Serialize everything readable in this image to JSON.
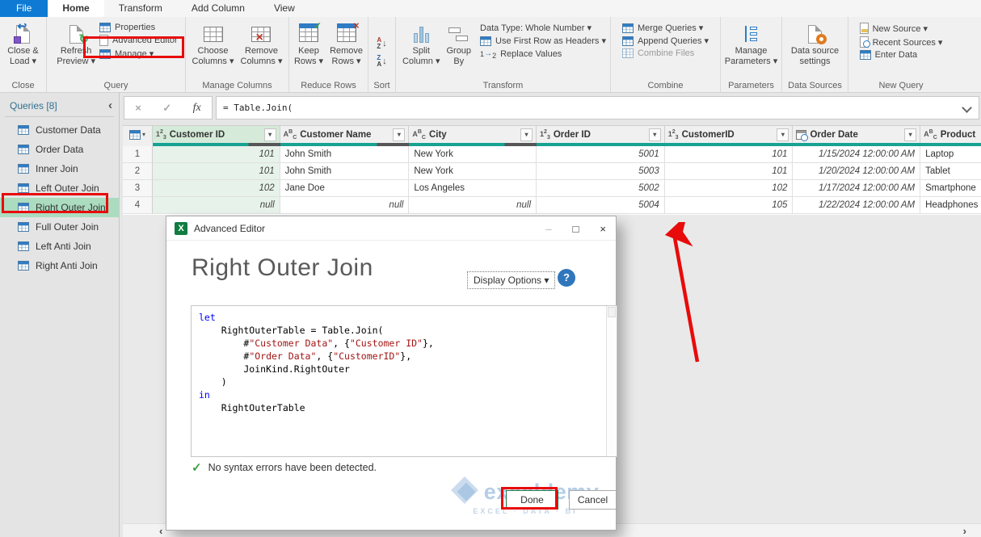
{
  "tabs": {
    "file": "File",
    "home": "Home",
    "transform": "Transform",
    "add_column": "Add Column",
    "view": "View"
  },
  "ribbon": {
    "close": {
      "group": "Close",
      "l1": "Close &",
      "l2": "Load ▾"
    },
    "query": {
      "group": "Query",
      "refresh1": "Refresh",
      "refresh2": "Preview ▾",
      "properties": "Properties",
      "advanced_editor": "Advanced Editor",
      "manage": "Manage ▾"
    },
    "manage_columns": {
      "group": "Manage Columns",
      "choose1": "Choose",
      "choose2": "Columns ▾",
      "remove1": "Remove",
      "remove2": "Columns ▾"
    },
    "reduce_rows": {
      "group": "Reduce Rows",
      "keep1": "Keep",
      "keep2": "Rows ▾",
      "remove1": "Remove",
      "remove2": "Rows ▾"
    },
    "sort": {
      "group": "Sort",
      "az_a": "A",
      "az_z": "Z",
      "za_z": "Z",
      "za_a": "A",
      "arrow": "↓"
    },
    "transform": {
      "group": "Transform",
      "split1": "Split",
      "split2": "Column ▾",
      "group1": "Group",
      "group2": "By",
      "data_type": "Data Type: Whole Number ▾",
      "first_row": "Use First Row as Headers ▾",
      "replace": "Replace Values",
      "rv1": "1",
      "rv2": "2",
      "rv_arrow": "→"
    },
    "combine": {
      "group": "Combine",
      "merge": "Merge Queries ▾",
      "append": "Append Queries ▾",
      "combine_files": "Combine Files"
    },
    "parameters": {
      "group": "Parameters",
      "l1": "Manage",
      "l2": "Parameters ▾"
    },
    "data_sources": {
      "group": "Data Sources",
      "l1": "Data source",
      "l2": "settings"
    },
    "new_query": {
      "group": "New Query",
      "new_source": "New Source ▾",
      "recent": "Recent Sources ▾",
      "enter": "Enter Data"
    }
  },
  "formula_bar": {
    "cancel": "×",
    "check": "✓",
    "fx": "fx",
    "expression": "= Table.Join("
  },
  "sidebar": {
    "title": "Queries [8]",
    "collapse": "‹",
    "items": [
      {
        "label": "Customer Data",
        "selected": false
      },
      {
        "label": "Order Data",
        "selected": false
      },
      {
        "label": "Inner Join",
        "selected": false
      },
      {
        "label": "Left Outer Join",
        "selected": false
      },
      {
        "label": "Right Outer Join",
        "selected": true
      },
      {
        "label": "Full Outer Join",
        "selected": false
      },
      {
        "label": "Left Anti Join",
        "selected": false
      },
      {
        "label": "Right Anti Join",
        "selected": false
      }
    ]
  },
  "grid": {
    "columns": [
      {
        "label": "Customer ID",
        "type": "number"
      },
      {
        "label": "Customer Name",
        "type": "text"
      },
      {
        "label": "City",
        "type": "text"
      },
      {
        "label": "Order ID",
        "type": "number"
      },
      {
        "label": "CustomerID",
        "type": "number"
      },
      {
        "label": "Order Date",
        "type": "datetime"
      },
      {
        "label": "Product",
        "type": "text"
      }
    ],
    "rows": [
      {
        "num": "1",
        "cells": [
          "101",
          "John Smith",
          "New York",
          "5001",
          "101",
          "1/15/2024 12:00:00 AM",
          "Laptop"
        ]
      },
      {
        "num": "2",
        "cells": [
          "101",
          "John Smith",
          "New York",
          "5003",
          "101",
          "1/20/2024 12:00:00 AM",
          "Tablet"
        ]
      },
      {
        "num": "3",
        "cells": [
          "102",
          "Jane Doe",
          "Los Angeles",
          "5002",
          "102",
          "1/17/2024 12:00:00 AM",
          "Smartphone"
        ]
      },
      {
        "num": "4",
        "cells": [
          "null",
          "null",
          "null",
          "5004",
          "105",
          "1/22/2024 12:00:00 AM",
          "Headphones"
        ]
      }
    ]
  },
  "dialog": {
    "title": "Advanced Editor",
    "window": {
      "minimize": "–",
      "maximize": "□",
      "close": "×"
    },
    "heading": "Right Outer Join",
    "display_options": "Display Options  ▾",
    "help": "?",
    "code": [
      {
        "segs": [
          {
            "t": "let",
            "c": "k"
          }
        ]
      },
      {
        "segs": [
          {
            "t": "    RightOuterTable = Table.Join(",
            "c": "p"
          }
        ]
      },
      {
        "segs": [
          {
            "t": "        #",
            "c": "p"
          },
          {
            "t": "\"Customer Data\"",
            "c": "s"
          },
          {
            "t": ", {",
            "c": "p"
          },
          {
            "t": "\"Customer ID\"",
            "c": "s"
          },
          {
            "t": "},",
            "c": "p"
          }
        ]
      },
      {
        "segs": [
          {
            "t": "        #",
            "c": "p"
          },
          {
            "t": "\"Order Data\"",
            "c": "s"
          },
          {
            "t": ", {",
            "c": "p"
          },
          {
            "t": "\"CustomerID\"",
            "c": "s"
          },
          {
            "t": "},",
            "c": "p"
          }
        ]
      },
      {
        "segs": [
          {
            "t": "        JoinKind.RightOuter",
            "c": "p"
          }
        ]
      },
      {
        "segs": [
          {
            "t": "    )",
            "c": "p"
          }
        ]
      },
      {
        "segs": [
          {
            "t": "in",
            "c": "k"
          }
        ]
      },
      {
        "segs": [
          {
            "t": "    RightOuterTable",
            "c": "p"
          }
        ]
      }
    ],
    "syntax_ok": "No syntax errors have been detected.",
    "syntax_check": "✓",
    "done": "Done",
    "cancel": "Cancel",
    "excel_icon_letter": "X",
    "watermark": {
      "name": "exceldemy",
      "tagline": "EXCEL · DATA · BI"
    }
  },
  "icons": {
    "caret": "▾",
    "n1": "1",
    "n2": "2",
    "n3": "3",
    "A": "A",
    "B": "B",
    "C": "C",
    "chev_left": "‹",
    "chev_right": "›",
    "x_mark": "×",
    "check": "✓"
  },
  "colors": {
    "accent_teal": "#17a292",
    "quality_gray": "#565656",
    "selection_green": "#abdcc0",
    "annotation_red": "#e80b0b",
    "tab_blue": "#0e7ad3",
    "keyword_blue": "#0000ff",
    "string_red": "#a31515",
    "excel_green": "#107c41"
  }
}
